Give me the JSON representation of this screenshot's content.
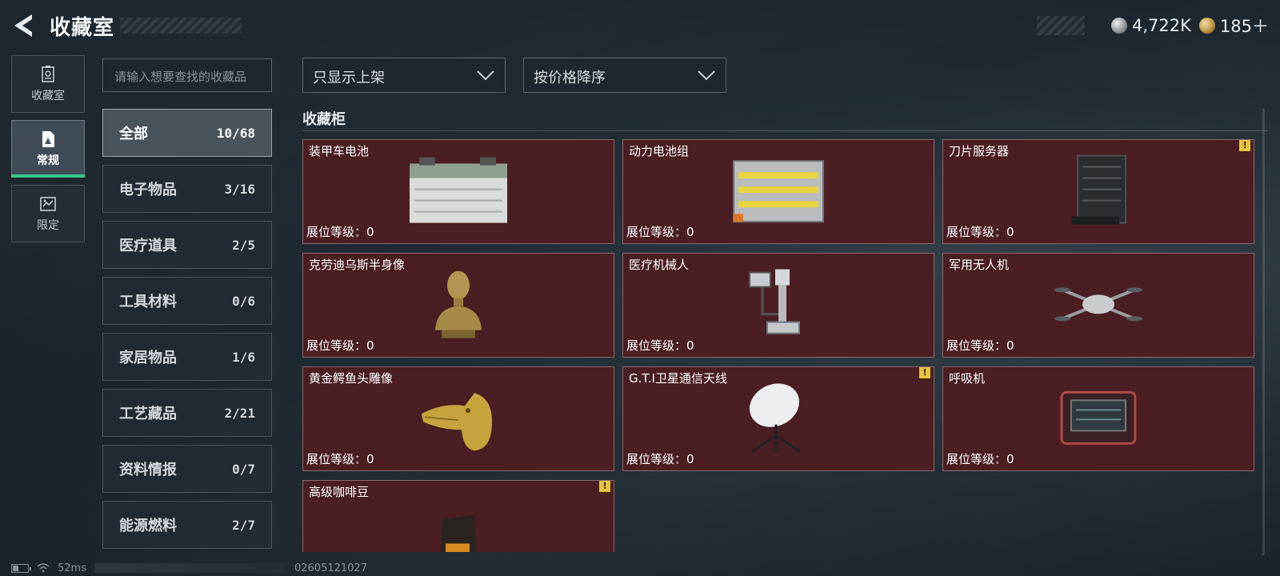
{
  "header": {
    "title": "收藏室",
    "currency": [
      {
        "icon": "silver-coin-icon",
        "value": "4,722K"
      },
      {
        "icon": "gold-coin-icon",
        "value": "185＋"
      }
    ]
  },
  "left_nav": [
    {
      "label": "收藏室",
      "icon": "collection-room-icon",
      "active": false
    },
    {
      "label": "常规",
      "icon": "regular-icon",
      "active": true
    },
    {
      "label": "限定",
      "icon": "limited-icon",
      "active": false
    }
  ],
  "search": {
    "placeholder": "请输入想要查找的收藏品"
  },
  "categories": [
    {
      "name": "全部",
      "count": "10/68",
      "active": true
    },
    {
      "name": "电子物品",
      "count": "3/16"
    },
    {
      "name": "医疗道具",
      "count": "2/5"
    },
    {
      "name": "工具材料",
      "count": "0/6"
    },
    {
      "name": "家居物品",
      "count": "1/6"
    },
    {
      "name": "工艺藏品",
      "count": "2/21"
    },
    {
      "name": "资料情报",
      "count": "0/7"
    },
    {
      "name": "能源燃料",
      "count": "2/7"
    }
  ],
  "filters": {
    "shelf_filter": "只显示上架",
    "sort_order": "按价格降序"
  },
  "section": {
    "title": "收藏柜"
  },
  "level_label": "展位等级：0",
  "items": [
    {
      "name": "装甲车电池",
      "icon": "battery-icon",
      "alert": false
    },
    {
      "name": "动力电池组",
      "icon": "power-battery-pack-icon",
      "alert": false
    },
    {
      "name": "刀片服务器",
      "icon": "blade-server-icon",
      "alert": true
    },
    {
      "name": "克劳迪乌斯半身像",
      "icon": "bust-icon",
      "alert": false
    },
    {
      "name": "医疗机械人",
      "icon": "medical-robot-icon",
      "alert": false
    },
    {
      "name": "军用无人机",
      "icon": "drone-icon",
      "alert": false
    },
    {
      "name": "黄金鳄鱼头雕像",
      "icon": "crocodile-statue-icon",
      "alert": false
    },
    {
      "name": "G.T.I卫星通信天线",
      "icon": "satellite-dish-icon",
      "alert": true
    },
    {
      "name": "呼吸机",
      "icon": "ventilator-icon",
      "alert": false
    },
    {
      "name": "高级咖啡豆",
      "icon": "coffee-bag-icon",
      "alert": true
    }
  ],
  "status": {
    "ping": "52ms",
    "build": "02605121027"
  },
  "colors": {
    "card_bg": "#4a1e22",
    "active_accent": "#35c98b",
    "alert": "#e8c23a"
  }
}
